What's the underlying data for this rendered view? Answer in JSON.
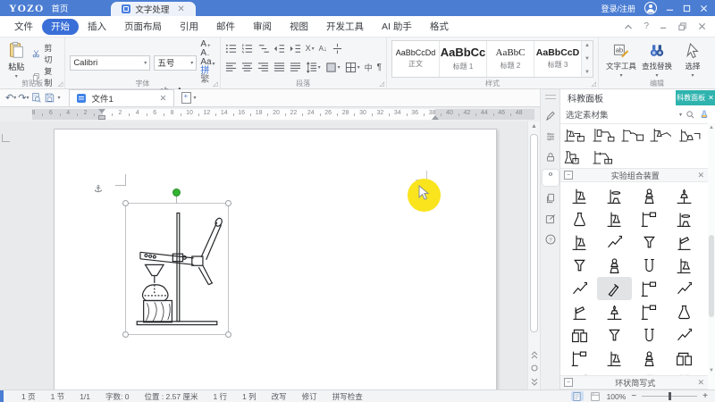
{
  "titlebar": {
    "brand": "YOZO",
    "home_label": "首页",
    "doc_tab_label": "文字处理",
    "login_label": "登录/注册"
  },
  "menubar": {
    "items": [
      "文件",
      "开始",
      "插入",
      "页面布局",
      "引用",
      "邮件",
      "审阅",
      "视图",
      "开发工具",
      "AI 助手",
      "格式"
    ],
    "active": "开始"
  },
  "ribbon": {
    "clipboard": {
      "group_label": "剪贴板",
      "paste_label": "粘贴",
      "cut_label": "剪切",
      "copy_label": "复制",
      "painter_label": "格式刷"
    },
    "font": {
      "group_label": "字体",
      "font_name": "Calibri",
      "font_size": "五号",
      "row1_icons": [
        "increase-font",
        "decrease-font",
        "change-case",
        "phonetic-guide",
        "sc-convert"
      ],
      "row2_icons": [
        "bold",
        "italic",
        "underline",
        "strikethrough",
        "subscript",
        "superscript",
        "text-effects",
        "highlight",
        "font-color",
        "char-shading"
      ]
    },
    "paragraph": {
      "group_label": "段落",
      "row1_icons": [
        "bullets",
        "numbering",
        "multilevel-list",
        "decrease-indent",
        "increase-indent",
        "text-direction",
        "sort",
        "indent-marks"
      ],
      "row2_icons": [
        "align-left",
        "align-center",
        "align-right",
        "justify",
        "distribute",
        "line-spacing",
        "shading",
        "borders",
        "asian-layout",
        "pilcrow"
      ]
    },
    "styles": {
      "group_label": "样式",
      "items": [
        {
          "sample": "AaBbCcDd",
          "label": "正文"
        },
        {
          "sample": "AaBbCc",
          "label": "标题 1"
        },
        {
          "sample": "AaBbC",
          "label": "标题 2"
        },
        {
          "sample": "AaBbCcD",
          "label": "标题 3"
        }
      ]
    },
    "editing": {
      "group_label": "编辑",
      "tools": [
        {
          "label": "文字工具",
          "icon": "text-tool"
        },
        {
          "label": "查找替换",
          "icon": "find-replace"
        },
        {
          "label": "选择",
          "icon": "select-cursor"
        }
      ]
    }
  },
  "subbar": {
    "doc_tab": "文件1"
  },
  "ruler": {
    "left_numbers": [
      "8",
      "6",
      "4",
      "2"
    ],
    "center_numbers": [
      "2",
      "4",
      "6",
      "8",
      "10",
      "12",
      "14",
      "16",
      "18",
      "20",
      "22",
      "24",
      "26",
      "28",
      "30",
      "32",
      "34",
      "36",
      "38"
    ],
    "right_numbers": [
      "40",
      "42",
      "44",
      "46",
      "48"
    ]
  },
  "panel": {
    "title": "科教面板",
    "badge_label": "科教面板",
    "selector_label": "选定素材集",
    "strip_icons": [
      "pencil",
      "sliders",
      "lock",
      "clipboard",
      "pages",
      "compose",
      "help"
    ],
    "strip_selected": "clipboard",
    "combo_icons_row1": [
      "combo1",
      "combo2",
      "combo3",
      "combo4",
      "combo5"
    ],
    "combo_icons_row2": [
      "combo6",
      "combo7"
    ],
    "sections": [
      {
        "title": "实验组合装置"
      },
      {
        "title": "环状简写式"
      }
    ],
    "grid_icons": [
      "stand-flask",
      "ring-stand",
      "kipp",
      "burner-stand",
      "erlenmeyer",
      "stand-flask",
      "clamp-rod",
      "ring-stand",
      "stand-flask",
      "bent-tube",
      "funnel",
      "test-tube",
      "funnel",
      "kipp",
      "u-tube",
      "stand-flask",
      "bent-tube",
      "tilt-tube",
      "clamp-rod",
      "bent-tube",
      "test-tube",
      "burner-stand",
      "clamp-rod",
      "erlenmeyer",
      "gas-bottles",
      "funnel",
      "u-tube",
      "bent-tube",
      "clamp-rod",
      "stand-flask",
      "kipp",
      "gas-bottles",
      "bent-tube",
      "ring-stand",
      "erlenmeyer",
      "u-tube"
    ],
    "grid_selected_index": 17
  },
  "statusbar": {
    "items": [
      "1 页",
      "1 节",
      "1/1",
      "字数: 0",
      "位置 : 2.57 厘米",
      "1 行",
      "1 列",
      "改写",
      "修订",
      "拼写检查"
    ],
    "zoom_label": "100%"
  },
  "colors": {
    "titlebar_blue": "#4b7dd3",
    "active_menu_blue": "#3a6fd8",
    "panel_badge_teal": "#2fb3ae",
    "highlight_yellow": "#f9e41e",
    "rotate_handle_green": "#34b233"
  }
}
